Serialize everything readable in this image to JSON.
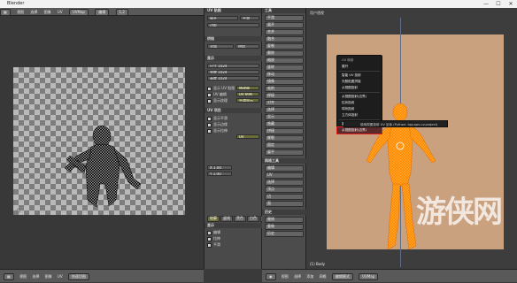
{
  "window": {
    "title": "Blender",
    "controls": [
      "—",
      "☐",
      "✕"
    ]
  },
  "menu": {
    "items": [
      "视图",
      "选择",
      "图像",
      "UV"
    ],
    "image_name": "UVMap",
    "mode": "编辑",
    "frame_label": "1,2"
  },
  "uv_editor": {
    "bottom": {
      "items": [
        "视图",
        "选择",
        "图像",
        "UV"
      ],
      "field": "快速切图"
    }
  },
  "properties": {
    "header": "UV 贴图",
    "section_smooth": "展开",
    "smooth_btn": "平滑",
    "margin_field": "边距",
    "section_bake": "烘焙",
    "bake_mode": "全部",
    "bake_btn": "烘焙",
    "section_display": "显示",
    "fields": [
      "尺寸 1024",
      "宽度 1024",
      "高度 1024"
    ],
    "checkbox_labels": [
      "显示 UV 贴图",
      "UV 编辑",
      "显示纹理",
      "显示平滑",
      "显示边缘",
      "显示拉伸"
    ],
    "highlight_values": [
      "修改器",
      "UV 贴图",
      "平滑显示"
    ],
    "coord_fields": [
      "X 1.00",
      "Y 1.00"
    ],
    "section_uv": "UV 项目",
    "sub_tabs": [
      "轮廓",
      "虚线",
      "黑色",
      "白色",
      "外框"
    ],
    "section_bottom": "显示",
    "bottom_checks": [
      "编辑",
      "拉伸",
      "平滑"
    ]
  },
  "tools": {
    "header": "工具",
    "buttons": [
      "平滑",
      "展开",
      "合并",
      "融合",
      "复制",
      "删除",
      "缩放",
      "旋转",
      "移动",
      "镜像",
      "吸附",
      "焊接",
      "对齐",
      "选择",
      "显示",
      "隐藏",
      "拼接",
      "撕裂",
      "固定",
      "展平"
    ],
    "section2": "网格工具",
    "buttons2": [
      "编辑",
      "UV",
      "选择",
      "顶点",
      "边",
      "面"
    ],
    "section3": "历史",
    "buttons3": [
      "撤销",
      "重做",
      "历史"
    ]
  },
  "viewport": {
    "header_label": "用户透视",
    "corner_label": "(1) Body",
    "bottom_items": [
      "视图",
      "选择",
      "添加",
      "网格",
      "编辑模式"
    ],
    "bottom_field": "UVMap"
  },
  "context_menu": {
    "title": "UV 映射",
    "items": [
      "展开",
      "智能 UV 投射",
      "光照贴图拼接",
      "从视图投射",
      "从视图投射(边界)",
      "柱状投射",
      "球状投射",
      "立方体投射",
      "重置",
      "从视图投射(边界)"
    ],
    "selected_index": 9,
    "separator_after": [
      0,
      3,
      7
    ]
  },
  "tooltip": {
    "text": "使用视图投射 UV 坐标 (Python: bpy.ops.uv.project)"
  },
  "watermark": {
    "brand": "游侠网"
  },
  "colors": {
    "accent": "#ff8a00",
    "selection_outline": "#e02020",
    "plane": "#caa17e"
  }
}
